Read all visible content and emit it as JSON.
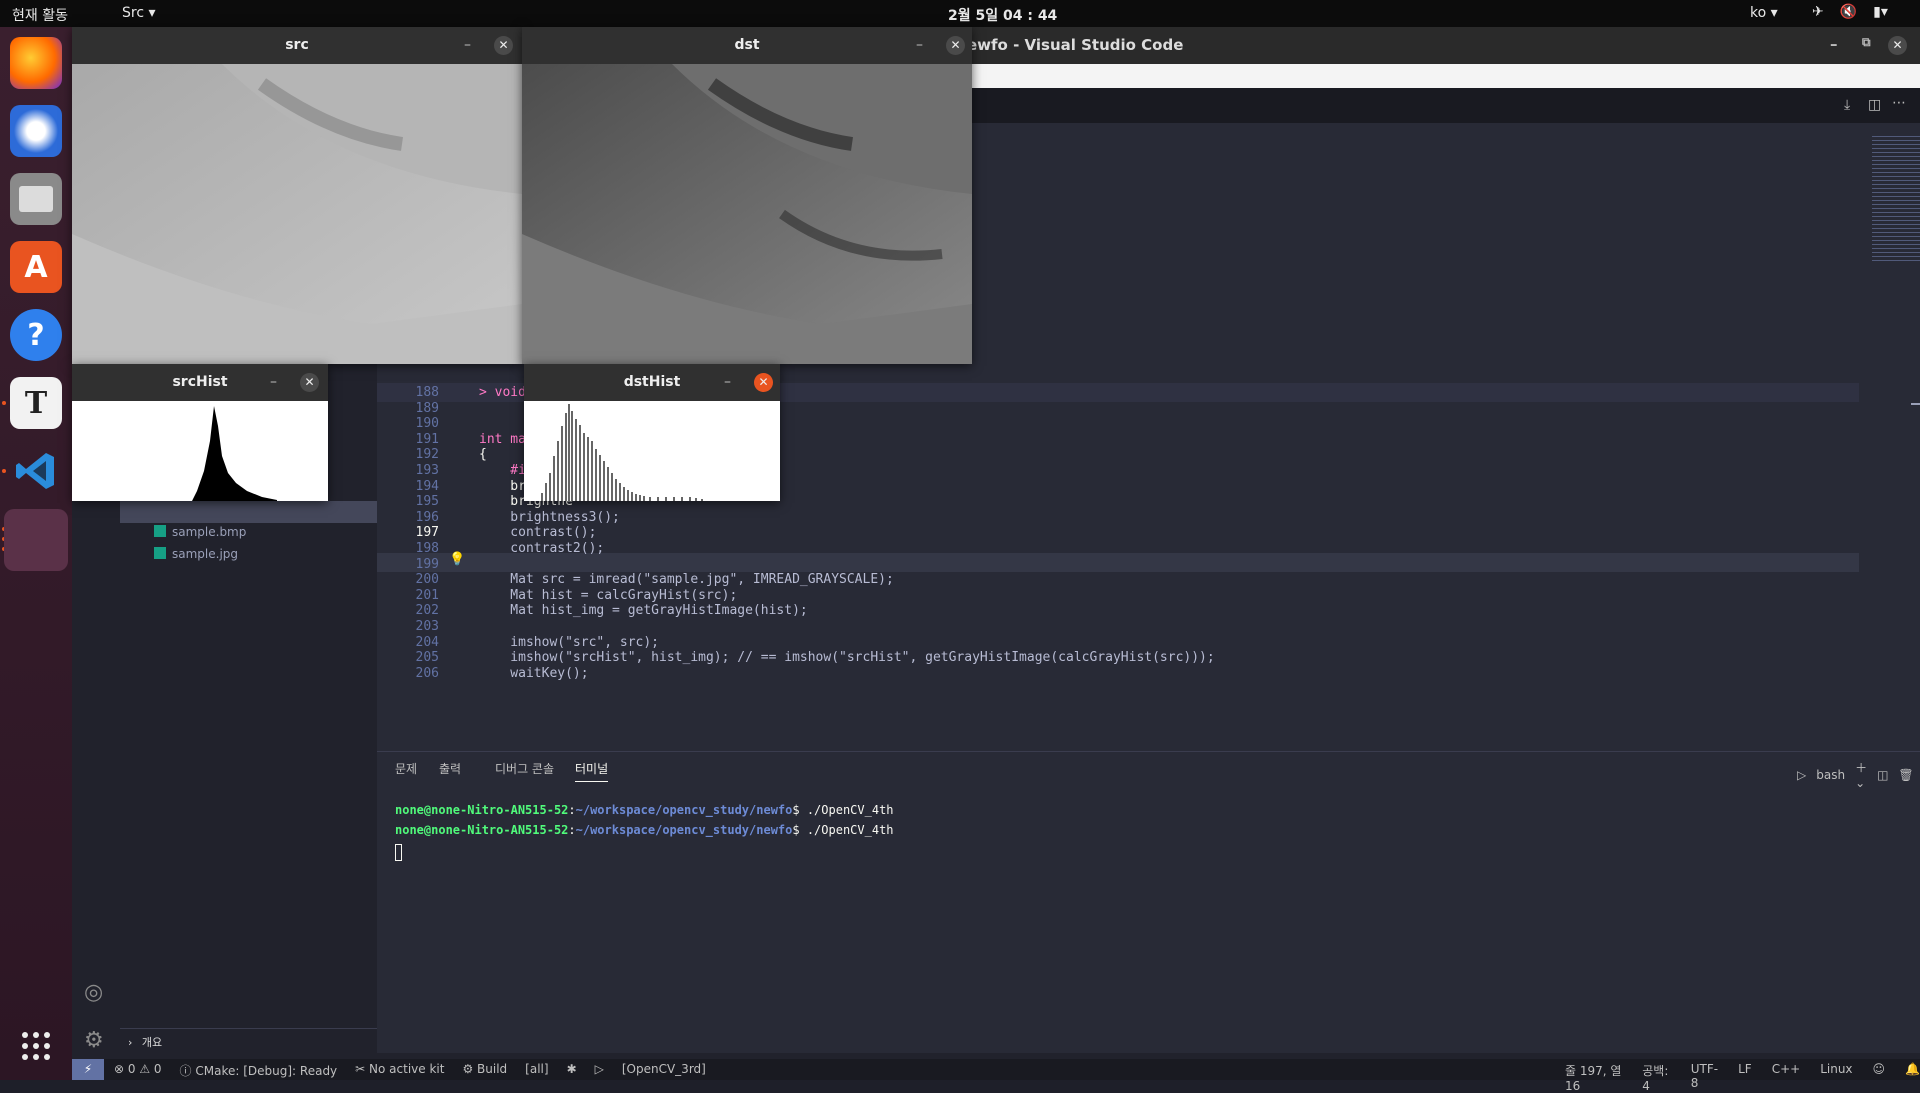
{
  "topbar": {
    "activities": "현재 활동",
    "app_menu": "Src ▾",
    "clock": "2월 5일  04 : 44",
    "lang": "ko ▾"
  },
  "vscode": {
    "title": "ewfo - Visual Studio Code",
    "explorer_files": [
      "sample.bmp",
      "sample.jpg"
    ],
    "outline_label": "개요",
    "code_lines": [
      {
        "n": "188",
        "text": "> void histgo"
      },
      {
        "n": "189",
        "text": ""
      },
      {
        "n": "190",
        "text": ""
      },
      {
        "n": "191",
        "text": "int main()"
      },
      {
        "n": "192",
        "text": "{"
      },
      {
        "n": "193",
        "text": "    #if 0"
      },
      {
        "n": "194",
        "text": "    brightne"
      },
      {
        "n": "195",
        "text": "    brightne"
      },
      {
        "n": "196",
        "text": "    brightness3();"
      },
      {
        "n": "197",
        "text": "    contrast();"
      },
      {
        "n": "198",
        "text": "    contrast2();"
      },
      {
        "n": "199",
        "text": ""
      },
      {
        "n": "200",
        "text": "    Mat src = imread(\"sample.jpg\", IMREAD_GRAYSCALE);"
      },
      {
        "n": "201",
        "text": "    Mat hist = calcGrayHist(src);"
      },
      {
        "n": "202",
        "text": "    Mat hist_img = getGrayHistImage(hist);"
      },
      {
        "n": "203",
        "text": ""
      },
      {
        "n": "204",
        "text": "    imshow(\"src\", src);"
      },
      {
        "n": "205",
        "text": "    imshow(\"srcHist\", hist_img); // == imshow(\"srcHist\", getGrayHistImage(calcGrayHist(src)));"
      },
      {
        "n": "206",
        "text": "    waitKey();"
      }
    ],
    "panel_tabs": [
      "문제",
      "출력",
      "디버그 콘솔",
      "터미널"
    ],
    "terminal_shell": "bash",
    "terminal_lines": [
      {
        "user": "none@none-Nitro-AN515-52",
        "path": "~/workspace/opencv_study/newfo",
        "cmd": "./OpenCV_4th"
      },
      {
        "user": "none@none-Nitro-AN515-52",
        "path": "~/workspace/opencv_study/newfo",
        "cmd": "./OpenCV_4th"
      }
    ],
    "status": {
      "errors": "0",
      "warnings": "0",
      "cmake": "CMake: [Debug]: Ready",
      "kit": "No active kit",
      "build": "Build",
      "all": "[all]",
      "target": "[OpenCV_3rd]",
      "position": "줄 197, 열 16",
      "spaces": "공백: 4",
      "encoding": "UTF-8",
      "eol": "LF",
      "language": "C++",
      "platform": "Linux"
    }
  },
  "windows": {
    "src": "src",
    "dst": "dst",
    "srcHist": "srcHist",
    "dstHist": "dstHist"
  }
}
